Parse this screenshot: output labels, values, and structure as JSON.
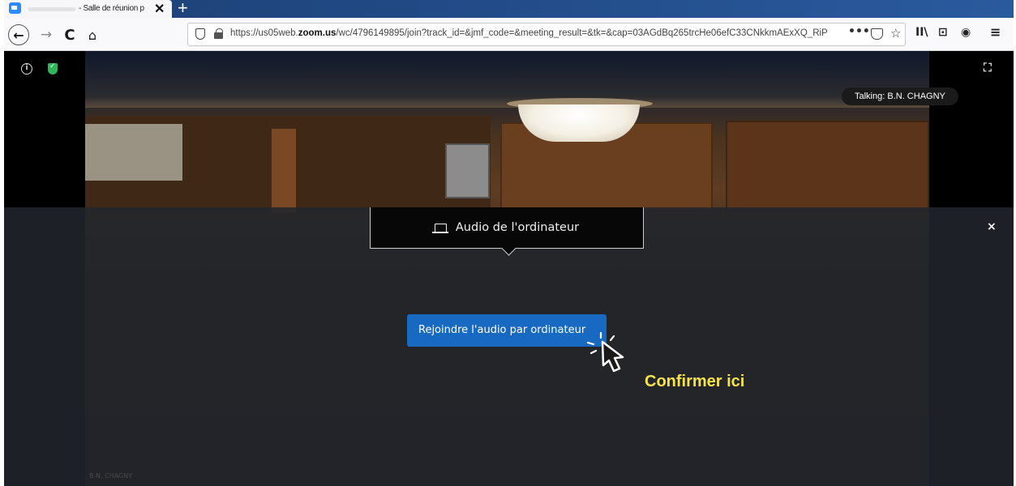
{
  "browser": {
    "tab_title": "- Salle de réunion p",
    "tab_close": "✕",
    "new_tab": "+",
    "nav": {
      "back": "←",
      "forward": "→",
      "reload": "C",
      "home": "⌂"
    },
    "url_prefix": "https://us05web.",
    "url_domain": "zoom.us",
    "url_rest": "/wc/4796149895/join?track_id=&jmf_code=&meeting_result=&tk=&cap=03AGdBq265trcHe06efC33CNkkmAExXQ_RiP",
    "url_more": "•••",
    "url_star": "☆",
    "toolbar": {
      "library": "II\\",
      "reader": "⊡",
      "account": "◉",
      "menu": "≡"
    }
  },
  "meeting": {
    "info_icon": "i",
    "expand_icon": "⛶",
    "talking_label": "Talking: B.N. CHAGNY",
    "overlay_close": "×",
    "audio_tab_label": "Audio de l'ordinateur",
    "join_button_label": "Rejoindre l'audio par ordinateur",
    "hint_text": "Confirmer ici",
    "participant_name": "B.N. CHAGNY"
  },
  "colors": {
    "join_button": "#1769c1",
    "hint": "#f7e34b",
    "shield": "#2fb45a"
  }
}
